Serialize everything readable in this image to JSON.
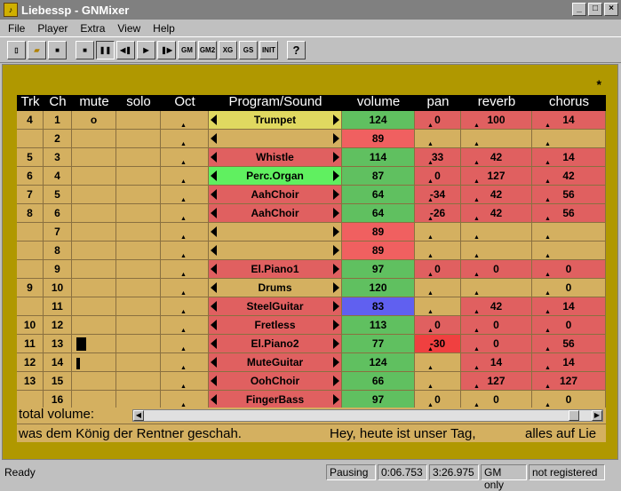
{
  "window": {
    "title": "Liebessp - GNMixer"
  },
  "menu": [
    "File",
    "Player",
    "Extra",
    "View",
    "Help"
  ],
  "toolbar": [
    "new",
    "open",
    "save",
    "stop",
    "pause",
    "rewind",
    "play",
    "forward",
    "GM",
    "GM2",
    "XG",
    "GS",
    "INIT",
    "?"
  ],
  "headers": [
    "Trk",
    "Ch",
    "mute",
    "solo",
    "Oct",
    "Program/Sound",
    "volume",
    "pan",
    "reverb",
    "chorus"
  ],
  "star": "*",
  "rows": [
    {
      "trk": "4",
      "ch": "1",
      "mute": "o",
      "program": "Trumpet",
      "progColor": "#e0d860",
      "volume": "124",
      "volColor": "#60c060",
      "pan": "0",
      "panColor": "#e06060",
      "reverb": "100",
      "revColor": "#e06060",
      "chorus": "14",
      "chColor": "#e06060",
      "peak": 0
    },
    {
      "trk": "",
      "ch": "2",
      "mute": "",
      "program": "",
      "progColor": "#d4b060",
      "volume": "89",
      "volColor": "#f06060",
      "pan": "",
      "panColor": "",
      "reverb": "",
      "revColor": "",
      "chorus": "",
      "chColor": "",
      "peak": 0
    },
    {
      "trk": "5",
      "ch": "3",
      "mute": "",
      "program": "Whistle",
      "progColor": "#e06060",
      "volume": "114",
      "volColor": "#60c060",
      "pan": "33",
      "panColor": "#e06060",
      "reverb": "42",
      "revColor": "#e06060",
      "chorus": "14",
      "chColor": "#e06060",
      "peak": 0
    },
    {
      "trk": "6",
      "ch": "4",
      "mute": "",
      "program": "Perc.Organ",
      "progColor": "#60f060",
      "volume": "87",
      "volColor": "#60c060",
      "pan": "0",
      "panColor": "#e06060",
      "reverb": "127",
      "revColor": "#e06060",
      "chorus": "42",
      "chColor": "#e06060",
      "peak": 0
    },
    {
      "trk": "7",
      "ch": "5",
      "mute": "",
      "program": "AahChoir",
      "progColor": "#e06060",
      "volume": "64",
      "volColor": "#60c060",
      "pan": "-34",
      "panColor": "#e06060",
      "reverb": "42",
      "revColor": "#e06060",
      "chorus": "56",
      "chColor": "#e06060",
      "peak": 0
    },
    {
      "trk": "8",
      "ch": "6",
      "mute": "",
      "program": "AahChoir",
      "progColor": "#e06060",
      "volume": "64",
      "volColor": "#60c060",
      "pan": "-26",
      "panColor": "#e06060",
      "reverb": "42",
      "revColor": "#e06060",
      "chorus": "56",
      "chColor": "#e06060",
      "peak": 0
    },
    {
      "trk": "",
      "ch": "7",
      "mute": "",
      "program": "",
      "progColor": "#d4b060",
      "volume": "89",
      "volColor": "#f06060",
      "pan": "",
      "panColor": "",
      "reverb": "",
      "revColor": "",
      "chorus": "",
      "chColor": "",
      "peak": 0
    },
    {
      "trk": "",
      "ch": "8",
      "mute": "",
      "program": "",
      "progColor": "#d4b060",
      "volume": "89",
      "volColor": "#f06060",
      "pan": "",
      "panColor": "",
      "reverb": "",
      "revColor": "",
      "chorus": "",
      "chColor": "",
      "peak": 0
    },
    {
      "trk": "",
      "ch": "9",
      "mute": "",
      "program": "El.Piano1",
      "progColor": "#e06060",
      "volume": "97",
      "volColor": "#60c060",
      "pan": "0",
      "panColor": "#e06060",
      "reverb": "0",
      "revColor": "#e06060",
      "chorus": "0",
      "chColor": "#e06060",
      "peak": 0
    },
    {
      "trk": "9",
      "ch": "10",
      "mute": "",
      "program": "Drums",
      "progColor": "#d4b060",
      "volume": "120",
      "volColor": "#60c060",
      "pan": "",
      "panColor": "",
      "reverb": "",
      "revColor": "",
      "chorus": "0",
      "chColor": "",
      "peak": 0
    },
    {
      "trk": "",
      "ch": "11",
      "mute": "",
      "program": "SteelGuitar",
      "progColor": "#e06060",
      "volume": "83",
      "volColor": "#6060f0",
      "pan": "",
      "panColor": "",
      "reverb": "42",
      "revColor": "#e06060",
      "chorus": "14",
      "chColor": "#e06060",
      "peak": 0
    },
    {
      "trk": "10",
      "ch": "12",
      "mute": "",
      "program": "Fretless",
      "progColor": "#e06060",
      "volume": "113",
      "volColor": "#60c060",
      "pan": "0",
      "panColor": "#e06060",
      "reverb": "0",
      "revColor": "#e06060",
      "chorus": "0",
      "chColor": "#e06060",
      "peak": 0
    },
    {
      "trk": "11",
      "ch": "13",
      "mute": "",
      "program": "El.Piano2",
      "progColor": "#e06060",
      "volume": "77",
      "volColor": "#60c060",
      "pan": "-30",
      "panColor": "#f04040",
      "reverb": "0",
      "revColor": "#e06060",
      "chorus": "56",
      "chColor": "#e06060",
      "peak": 1
    },
    {
      "trk": "12",
      "ch": "14",
      "mute": "",
      "program": "MuteGuitar",
      "progColor": "#e06060",
      "volume": "124",
      "volColor": "#60c060",
      "pan": "",
      "panColor": "",
      "reverb": "14",
      "revColor": "#e06060",
      "chorus": "14",
      "chColor": "#e06060",
      "peak": 2
    },
    {
      "trk": "13",
      "ch": "15",
      "mute": "",
      "program": "OohChoir",
      "progColor": "#e06060",
      "volume": "66",
      "volColor": "#60c060",
      "pan": "",
      "panColor": "",
      "reverb": "127",
      "revColor": "#e06060",
      "chorus": "127",
      "chColor": "#e06060",
      "peak": 0
    },
    {
      "trk": "",
      "ch": "16",
      "mute": "",
      "program": "FingerBass",
      "progColor": "#e06060",
      "volume": "97",
      "volColor": "#60c060",
      "pan": "0",
      "panColor": "",
      "reverb": "0",
      "revColor": "",
      "chorus": "0",
      "chColor": "",
      "peak": 0
    }
  ],
  "total_volume_label": "total volume:",
  "lyrics": [
    "was dem König der Rentner geschah.",
    "Hey, heute ist unser Tag,",
    "alles auf Lie"
  ],
  "status": {
    "ready": "Ready",
    "state": "Pausing",
    "time": "0:06.753",
    "duration": "3:26.975",
    "mode": "GM only",
    "reg": "not registered"
  }
}
